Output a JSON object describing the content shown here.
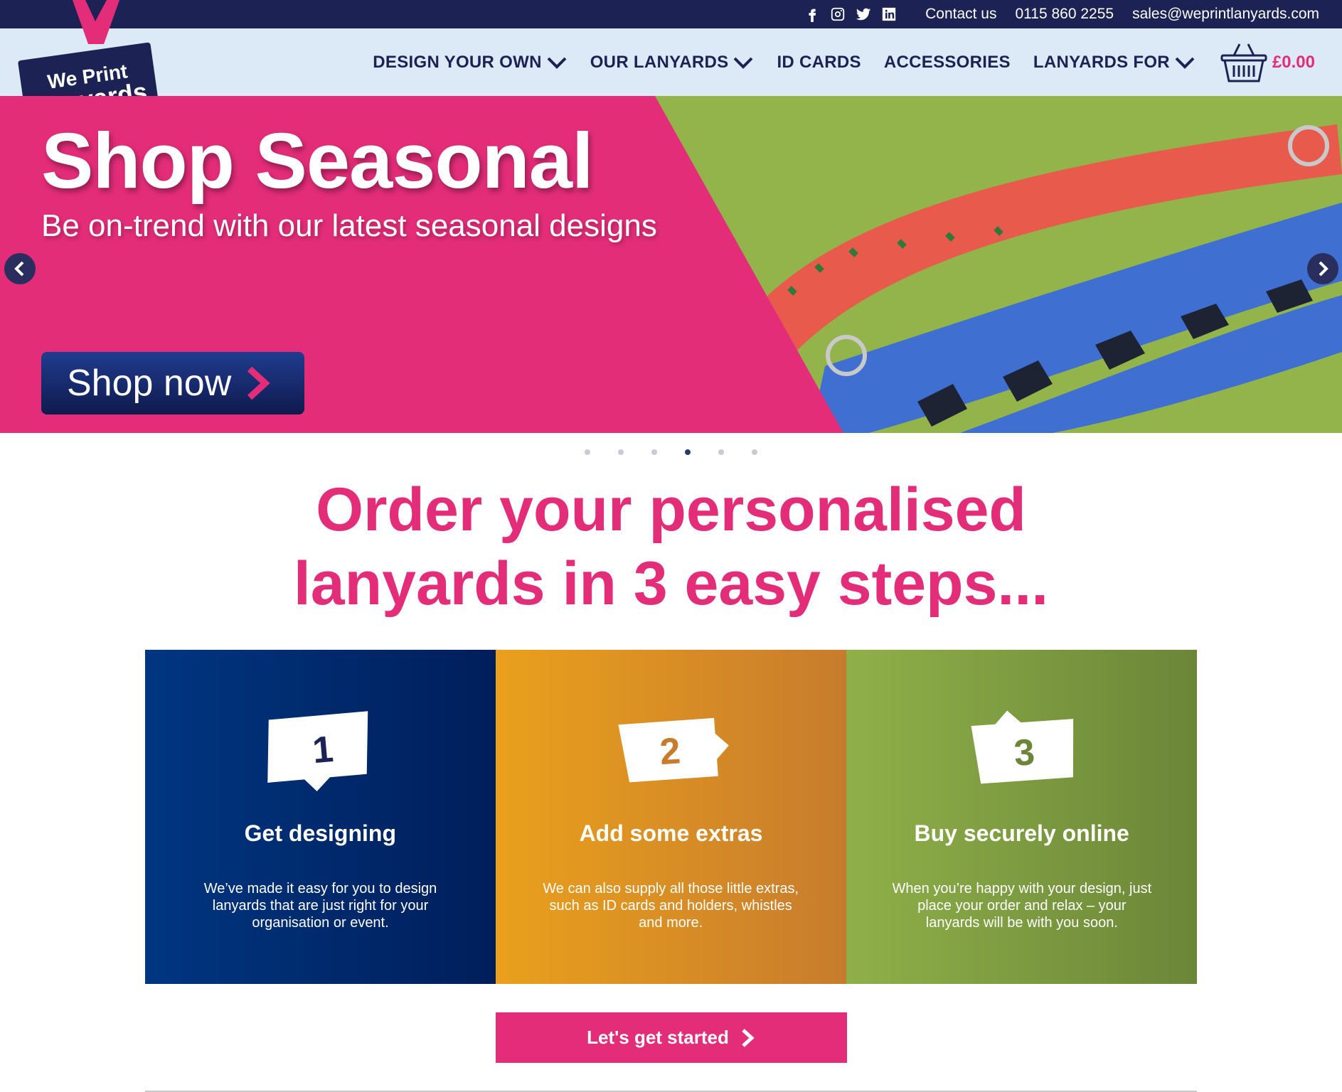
{
  "topbar": {
    "contact": "Contact us",
    "phone": "0115 860 2255",
    "email": "sales@weprintlanyards.com",
    "social_icons": [
      "facebook-icon",
      "instagram-icon",
      "twitter-icon",
      "linkedin-icon"
    ]
  },
  "logo": {
    "line1": "We Print",
    "line2": "Lanyards"
  },
  "nav": {
    "design_your_own": "DESIGN YOUR OWN",
    "our_lanyards": "OUR LANYARDS",
    "id_cards": "ID CARDS",
    "accessories": "ACCESSORIES",
    "lanyards_for": "LANYARDS FOR",
    "cart_total": "£0.00"
  },
  "hero": {
    "title": "Shop Seasonal",
    "subtitle": "Be on-trend with our latest seasonal designs",
    "button": "Shop now",
    "slide_count": 6,
    "active_slide": 4
  },
  "headline": {
    "line1": "Order your personalised",
    "line2": "lanyards in 3 easy steps..."
  },
  "steps": [
    {
      "number": "1",
      "title": "Get designing",
      "desc": "We’ve made it easy for you to design lanyards that are just right for your organisation or event."
    },
    {
      "number": "2",
      "title": "Add some extras",
      "desc": "We can also supply all those little extras, such as ID cards and holders, whistles and more."
    },
    {
      "number": "3",
      "title": "Buy securely online",
      "desc": "When you’re happy with your design, just place your order and relax – your lanyards will be with you soon."
    }
  ],
  "cta": {
    "label": "Let's get started"
  },
  "colors": {
    "navy": "#1c2354",
    "pink": "#e42d79",
    "green": "#92b44a",
    "header_bg": "#dce9f6",
    "step1": "#003681",
    "step2": "#eaa01c",
    "step3": "#8fb049"
  }
}
